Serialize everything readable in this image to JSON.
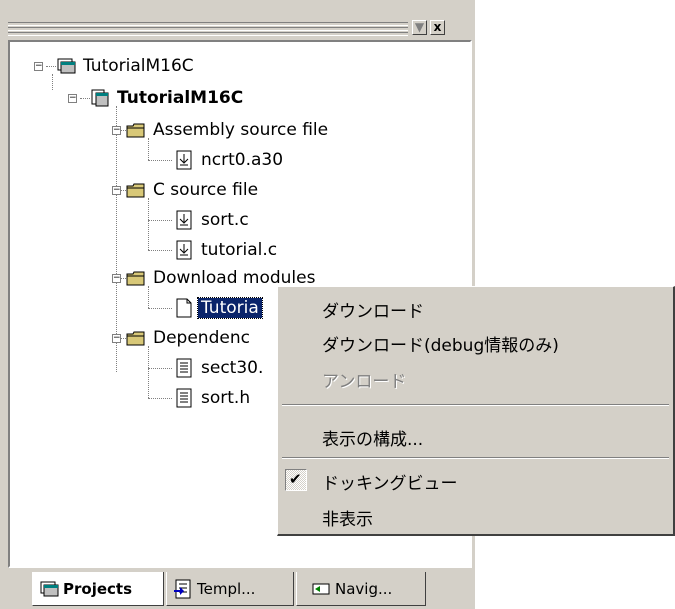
{
  "panel": {
    "close_glyph": "x",
    "min_glyph": "▼"
  },
  "tree": {
    "root": "TutorialM16C",
    "project": "TutorialM16C",
    "folders": [
      {
        "label": "Assembly source file",
        "files": [
          "ncrt0.a30"
        ]
      },
      {
        "label": "C source file",
        "files": [
          "sort.c",
          "tutorial.c"
        ]
      },
      {
        "label": "Download modules",
        "files": [
          "Tutoria"
        ]
      },
      {
        "label": "Dependenc",
        "files": [
          "sect30.",
          "sort.h"
        ]
      }
    ]
  },
  "tabs": [
    {
      "label": "Projects",
      "active": true
    },
    {
      "label": "Templ...",
      "active": false
    },
    {
      "label": "Navig...",
      "active": false
    }
  ],
  "context_menu": {
    "items": [
      {
        "label": "ダウンロード",
        "enabled": true
      },
      {
        "label": "ダウンロード(debug情報のみ)",
        "enabled": true
      },
      {
        "label": "アンロード",
        "enabled": false
      },
      {
        "label": "表示の構成...",
        "enabled": true
      },
      {
        "label": "ドッキングビュー",
        "enabled": true,
        "checked": true
      },
      {
        "label": "非表示",
        "enabled": true
      }
    ],
    "check_glyph": "✔"
  },
  "colors": {
    "face": "#d4d0c8",
    "selection": "#0a246a",
    "folder": "#d8c878"
  }
}
